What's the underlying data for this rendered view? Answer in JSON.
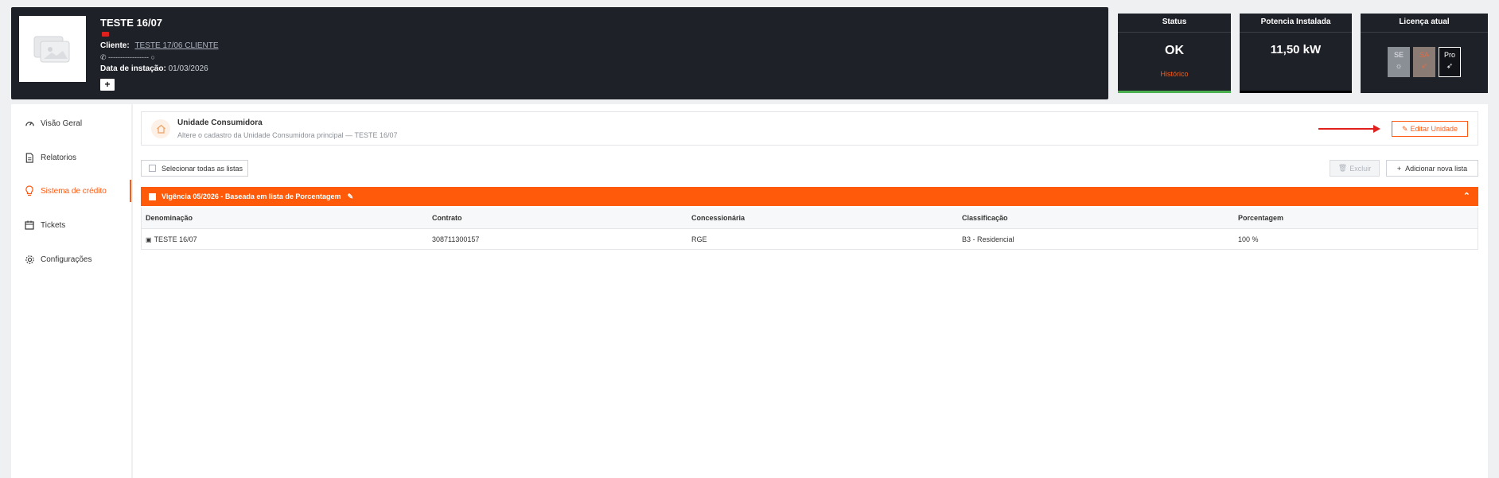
{
  "header": {
    "title": "TESTE 16/07",
    "client_label": "Cliente:",
    "client_value": "TESTE 17/06 CLIENTE",
    "phone": "✆ ----------------- ○",
    "install_label": "Data de instação:",
    "install_value": "01/03/2026",
    "add_label": "+"
  },
  "status_card": {
    "title": "Status",
    "value": "OK",
    "link": "Histórico",
    "bar_color": "#4caf50"
  },
  "power_card": {
    "title": "Potencia Instalada",
    "value": "11,50 kW"
  },
  "license_card": {
    "title": "Licença atual",
    "options": [
      {
        "label": "SE",
        "icon": "sun-icon"
      },
      {
        "label": "SA",
        "icon": "rocket-icon"
      },
      {
        "label": "Pro",
        "icon": "rocket-icon"
      }
    ]
  },
  "sidebar": {
    "items": [
      {
        "label": "Visão Geral",
        "icon": "gauge-icon"
      },
      {
        "label": "Relatorios",
        "icon": "document-icon"
      },
      {
        "label": "Sistema de crédito",
        "icon": "lightbulb-icon",
        "active": true
      },
      {
        "label": "Tickets",
        "icon": "calendar-icon"
      },
      {
        "label": "Configurações",
        "icon": "gear-icon"
      }
    ]
  },
  "uc": {
    "title": "Unidade Consumidora",
    "subtitle": "Altere o cadastro da Unidade Consumidora principal — TESTE 16/07",
    "edit_label": "Editar Unidade"
  },
  "toolbar": {
    "select_all": "Selecionar todas as listas",
    "delete_label": "Excluir",
    "add_label": "Adicionar nova lista"
  },
  "list_group": {
    "title": "Vigência 05/2026 - Baseada em lista de Porcentagem"
  },
  "table": {
    "headers": [
      "Denominação",
      "Contrato",
      "Concessionária",
      "Classificação",
      "Porcentagem"
    ],
    "rows": [
      [
        "TESTE 16/07",
        "308711300157",
        "RGE",
        "B3 - Residencial",
        "100 %"
      ]
    ]
  },
  "colors": {
    "accent": "#ff5a0a",
    "header_bg": "#1e2128",
    "status_ok": "#4caf50"
  }
}
